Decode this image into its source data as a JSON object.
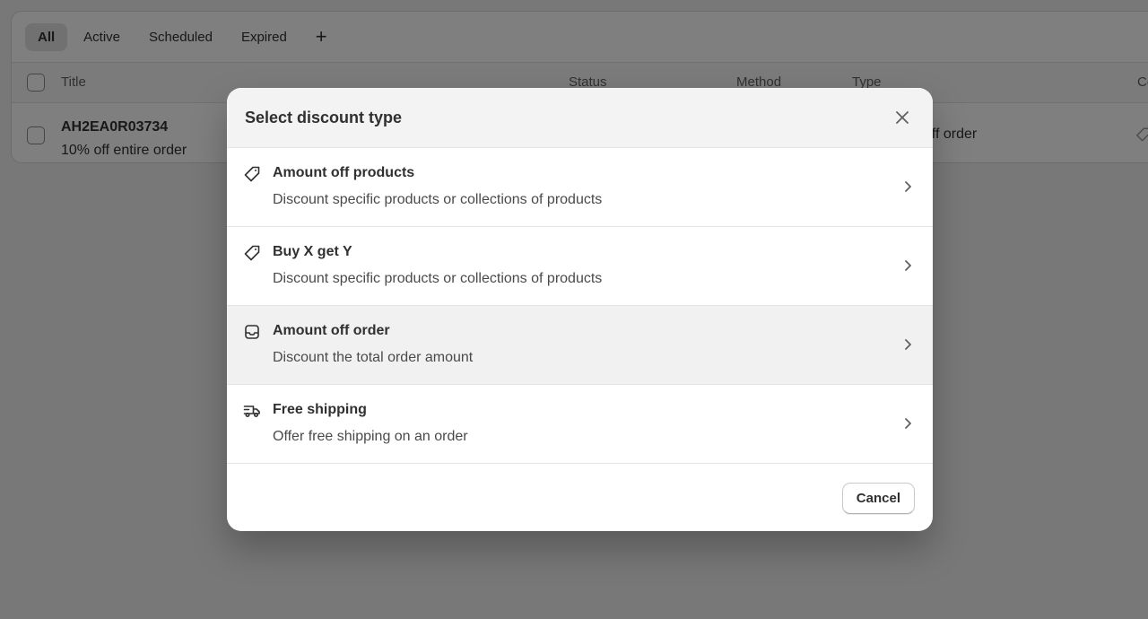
{
  "tabs": [
    "All",
    "Active",
    "Scheduled",
    "Expired"
  ],
  "tab_add_label": "+",
  "table": {
    "headers": {
      "title": "Title",
      "status": "Status",
      "method": "Method",
      "type": "Type",
      "combinations": "Cor"
    },
    "rows": [
      {
        "code": "AH2EA0R03734",
        "description": "10% off entire order",
        "type": "t off order"
      }
    ]
  },
  "modal": {
    "title": "Select discount type",
    "options": [
      {
        "title": "Amount off products",
        "description": "Discount specific products or collections of products",
        "icon": "tag-icon"
      },
      {
        "title": "Buy X get Y",
        "description": "Discount specific products or collections of products",
        "icon": "tag-icon"
      },
      {
        "title": "Amount off order",
        "description": "Discount the total order amount",
        "icon": "inbox-icon"
      },
      {
        "title": "Free shipping",
        "description": "Offer free shipping on an order",
        "icon": "truck-icon"
      }
    ],
    "cancel_label": "Cancel"
  },
  "colors": {
    "overlay": "#000000",
    "text": "#303030",
    "hover_row": "#f1f1f1"
  }
}
